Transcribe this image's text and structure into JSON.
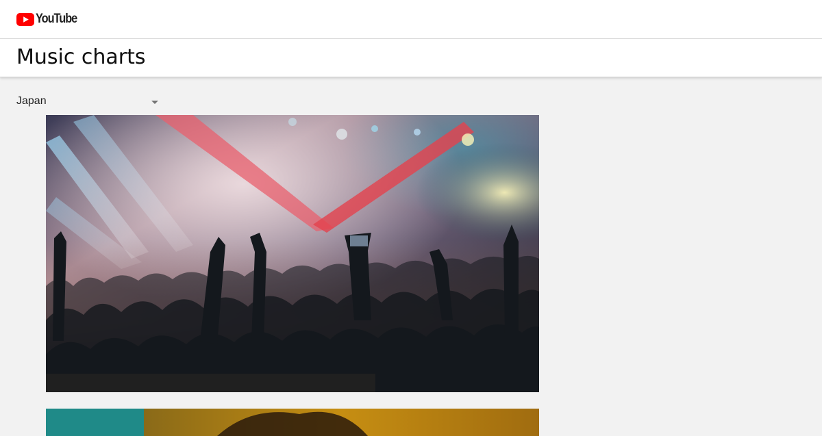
{
  "header": {
    "logo": {
      "icon": "youtube-play-icon",
      "text": "YouTube",
      "icon_color": "#ff0000"
    }
  },
  "page": {
    "title": "Music charts"
  },
  "filters": {
    "country": {
      "selected": "Japan",
      "icon": "dropdown-arrow-icon"
    }
  },
  "cards": [
    {
      "name": "concert-crowd-thumbnail"
    },
    {
      "name": "second-chart-thumbnail"
    }
  ],
  "colors": {
    "page_background": "#f2f2f2",
    "header_background": "#ffffff",
    "brand_red": "#ff0000",
    "text_primary": "#0f0f0f",
    "caption_bar": "#202020"
  }
}
